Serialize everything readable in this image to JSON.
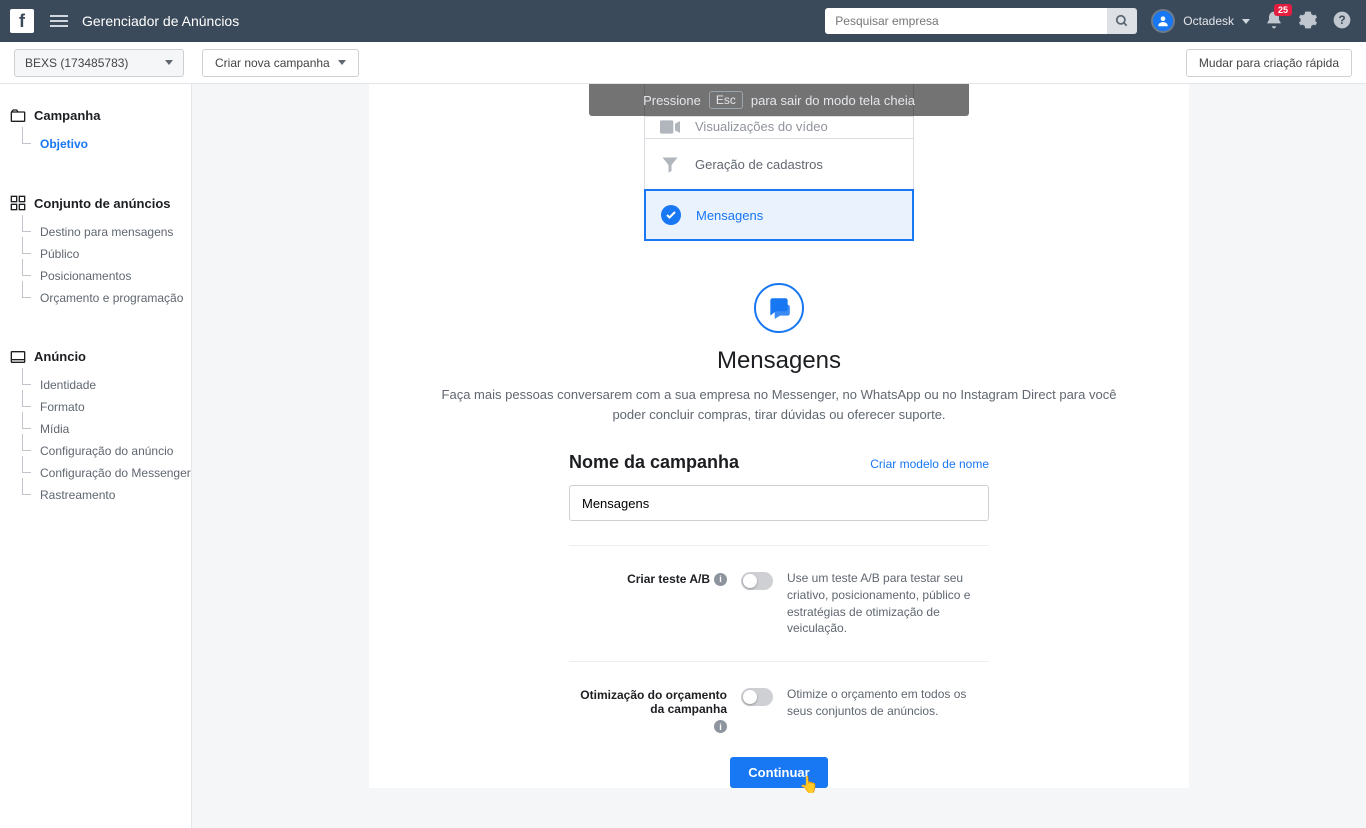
{
  "topbar": {
    "title": "Gerenciador de Anúncios",
    "search_placeholder": "Pesquisar empresa",
    "profile_name": "Octadesk",
    "notification_count": "25"
  },
  "secondbar": {
    "account_label": "BEXS (173485783)",
    "create_label": "Criar nova campanha",
    "switch_label": "Mudar para criação rápida"
  },
  "sidebar": {
    "campaign": {
      "title": "Campanha",
      "items": [
        "Objetivo"
      ],
      "active": 0
    },
    "adset": {
      "title": "Conjunto de anúncios",
      "items": [
        "Destino para mensagens",
        "Público",
        "Posicionamentos",
        "Orçamento e programação"
      ]
    },
    "ad": {
      "title": "Anúncio",
      "items": [
        "Identidade",
        "Formato",
        "Mídia",
        "Configuração do anúncio",
        "Configuração do Messenger",
        "Rastreamento"
      ]
    }
  },
  "esc_banner": {
    "prefix": "Pressione",
    "key": "Esc",
    "suffix": "para sair do modo tela cheia"
  },
  "objectives": {
    "video": "Visualizações do vídeo",
    "leads": "Geração de cadastros",
    "messages": "Mensagens"
  },
  "hero": {
    "title": "Mensagens",
    "desc": "Faça mais pessoas conversarem com a sua empresa no Messenger, no WhatsApp ou no Instagram Direct para você poder concluir compras, tirar dúvidas ou oferecer suporte."
  },
  "form": {
    "name_label": "Nome da campanha",
    "name_template_link": "Criar modelo de nome",
    "name_value": "Mensagens",
    "ab_label": "Criar teste A/B",
    "ab_desc": "Use um teste A/B para testar seu criativo, posicionamento, público e estratégias de otimização de veiculação.",
    "budget_label": "Otimização do orçamento da campanha",
    "budget_desc": "Otimize o orçamento em todos os seus conjuntos de anúncios.",
    "continue": "Continuar"
  }
}
